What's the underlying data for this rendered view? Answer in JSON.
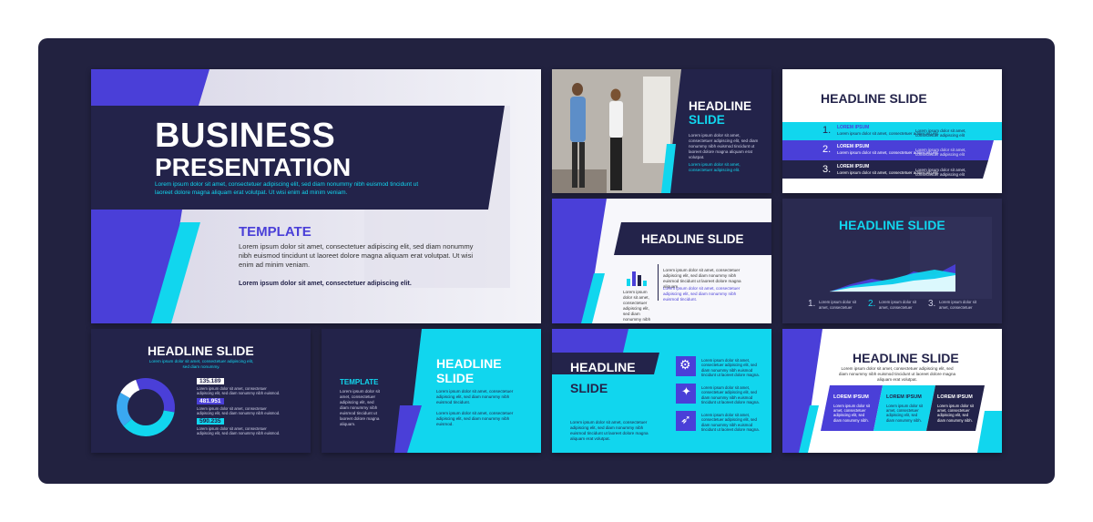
{
  "colors": {
    "navy": "#23234a",
    "indigo": "#4b3fd6",
    "cyan": "#11d6ee",
    "frame": "#222240"
  },
  "main": {
    "title1": "BUSINESS",
    "title2": "PRESENTATION",
    "subtitle": "Lorem ipsum dolor sit amet, consectetuer adipiscing elit, sed diam nonummy nibh euismod tincidunt ut laoreet dolore magna aliquam erat volutpat. Ut wisi enim ad minim veniam.",
    "template": "TEMPLATE",
    "body": "Lorem ipsum dolor sit amet, consectetuer adipiscing elit, sed diam nonummy nibh euismod tincidunt ut laoreet dolore magna aliquam erat volutpat. Ut wisi enim ad minim veniam.",
    "tagline": "Lorem ipsum dolor sit amet, consectetuer adipiscing elit."
  },
  "s2": {
    "h1": "HEADLINE",
    "h2": "SLIDE",
    "body": "Lorem ipsum dolor sit amet, consectetuer adipiscing elit, sed diam nonummy nibh euismod tincidunt ut laoreet dolore magna aliquam erat volutpat.",
    "small": "Lorem ipsum dolor sit amet, consectetuer adipiscing elit."
  },
  "s3": {
    "title": "HEADLINE SLIDE",
    "items": [
      {
        "num": "1.",
        "label": "LOREM IPSUM",
        "text": "Lorem ipsum dolor sit amet, consectetuer adipiscing elit"
      },
      {
        "num": "2.",
        "label": "LOREM IPSUM",
        "text": "Lorem ipsum dolor sit amet, consectetuer adipiscing elit"
      },
      {
        "num": "3.",
        "label": "LOREM IPSUM",
        "text": "Lorem ipsum dolor sit amet, consectetuer adipiscing elit"
      }
    ]
  },
  "s4": {
    "title": "HEADLINE SLIDE",
    "body": "Lorem ipsum dolor sit amet, consectetuer adipiscing elit, sed diam nonummy nibh euismod tincidunt ut laoreet dolore magna aliquam.",
    "body2": "Lorem ipsum dolor sit amet, consectetuer adipiscing elit, sed diam nonummy nibh euismod tincidunt."
  },
  "s5": {
    "title": "HEADLINE SLIDE",
    "body": "Lorem ipsum dolor sit amet, consectetuer adipiscing elit, sed diam nonummy nibh euismod tincidunt ut laoreet dolore magna aliquam erat volutpat.",
    "steps": [
      {
        "num": "1.",
        "text": "Lorem ipsum dolor sit amet, consectetuer"
      },
      {
        "num": "2.",
        "text": "Lorem ipsum dolor sit amet, consectetuer"
      },
      {
        "num": "3.",
        "text": "Lorem ipsum dolor sit amet, consectetuer"
      }
    ]
  },
  "s6": {
    "title": "HEADLINE SLIDE",
    "sub": "Lorem ipsum dolor sit amet, consectetuer adipiscing elit, sed diam nonummy.",
    "stats": [
      {
        "value": "135.189",
        "text": "Lorem ipsum dolor sit amet, consectetuer adipiscing elit, sed diam nonummy nibh euismod."
      },
      {
        "value": "481.951",
        "text": "Lorem ipsum dolor sit amet, consectetuer adipiscing elit, sed diam nonummy nibh euismod."
      },
      {
        "value": "590.235",
        "text": "Lorem ipsum dolor sit amet, consectetuer adipiscing elit, sed diam nonummy nibh euismod."
      }
    ]
  },
  "s7": {
    "template": "TEMPLATE",
    "left": "Lorem ipsum dolor sit amet, consectetuer adipiscing elit, sed diam nonummy nibh euismod tincidunt ut laoreet dolore magna aliquam.",
    "h1": "HEADLINE",
    "h2": "SLIDE",
    "body": "Lorem ipsum dolor sit amet, consectetuer adipiscing elit, sed diam nonummy nibh euismod tincidunt.",
    "body2": "Lorem ipsum dolor sit amet, consectetuer adipiscing elit, sed diam nonummy nibh euismod."
  },
  "s8": {
    "h1": "HEADLINE",
    "h2": "SLIDE",
    "body": "Lorem ipsum dolor sit amet, consectetuer adipiscing elit, sed diam nonummy nibh euismod tincidunt ut laoreet dolore magna aliquam erat volutpat.",
    "items": [
      "Lorem ipsum dolor sit amet, consectetuer adipiscing elit, sed diam nonummy nibh euismod tincidunt ut laoreet dolore magna.",
      "Lorem ipsum dolor sit amet, consectetuer adipiscing elit, sed diam nonummy nibh euismod tincidunt ut laoreet dolore magna.",
      "Lorem ipsum dolor sit amet, consectetuer adipiscing elit, sed diam nonummy nibh euismod tincidunt ut laoreet dolore magna."
    ]
  },
  "s9": {
    "title": "HEADLINE SLIDE",
    "sub": "Lorem ipsum dolor sit amet, consectetuer adipiscing elit, sed diam nonummy nibh euismod tincidunt ut laoreet dolore magna aliquam erat volutpat.",
    "cols": [
      {
        "label": "LOREM IPSUM",
        "text": "Lorem ipsum dolor sit amet, consectetuer adipiscing elit, sed diam nonummy nibh."
      },
      {
        "label": "LOREM IPSUM",
        "text": "Lorem ipsum dolor sit amet, consectetuer adipiscing elit, sed diam nonummy nibh."
      },
      {
        "label": "LOREM IPSUM",
        "text": "Lorem ipsum dolor sit amet, consectetuer adipiscing elit, sed diam nonummy nibh."
      }
    ]
  }
}
